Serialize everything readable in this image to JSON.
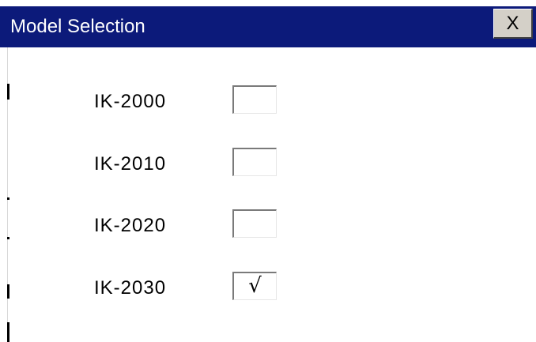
{
  "window": {
    "title": "Model Selection",
    "close_label": "X",
    "titlebar_color": "#0c1a7a"
  },
  "models": [
    {
      "label": "IK-2000",
      "checked": false,
      "mark": ""
    },
    {
      "label": "IK-2010",
      "checked": false,
      "mark": ""
    },
    {
      "label": "IK-2020",
      "checked": false,
      "mark": ""
    },
    {
      "label": "IK-2030",
      "checked": true,
      "mark": "√"
    }
  ]
}
